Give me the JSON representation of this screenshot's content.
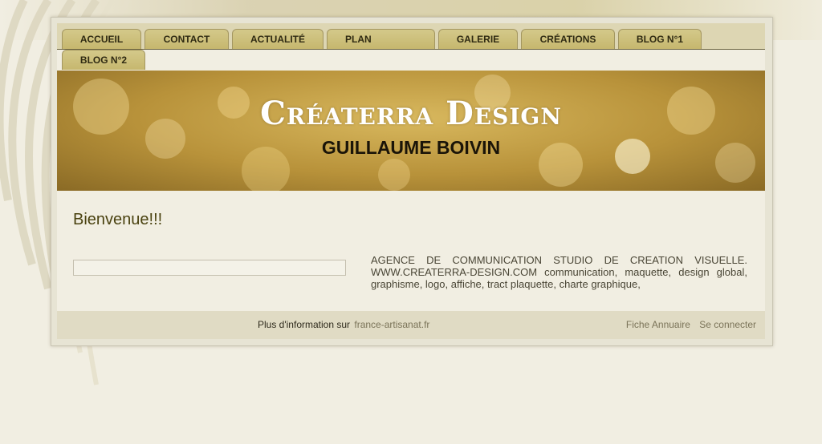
{
  "nav": {
    "tabs": [
      {
        "label": "ACCUEIL"
      },
      {
        "label": "CONTACT"
      },
      {
        "label": "ACTUALITÉ"
      },
      {
        "label": "PLAN"
      },
      {
        "label": "GALERIE"
      },
      {
        "label": "CRÉATIONS"
      },
      {
        "label": "BLOG N°1"
      },
      {
        "label": "BLOG N°2"
      }
    ]
  },
  "banner": {
    "title": "Créaterra Design",
    "subtitle": "GUILLAUME BOIVIN"
  },
  "content": {
    "welcome": "Bienvenue!!!",
    "description": "AGENCE DE COMMUNICATION STUDIO DE CREATION VISUELLE. WWW.CREATERRA-DESIGN.COM communication, maquette, design global, graphisme, logo, affiche, tract plaquette, charte graphique,"
  },
  "footer": {
    "info_prefix": "Plus d'information sur",
    "info_link": "france-artisanat.fr",
    "fiche_link": "Fiche Annuaire",
    "login_link": "Se connecter"
  },
  "colors": {
    "tab": "#c6b76e",
    "title_text": "#4a4210",
    "page_bg": "#f1eee2"
  }
}
